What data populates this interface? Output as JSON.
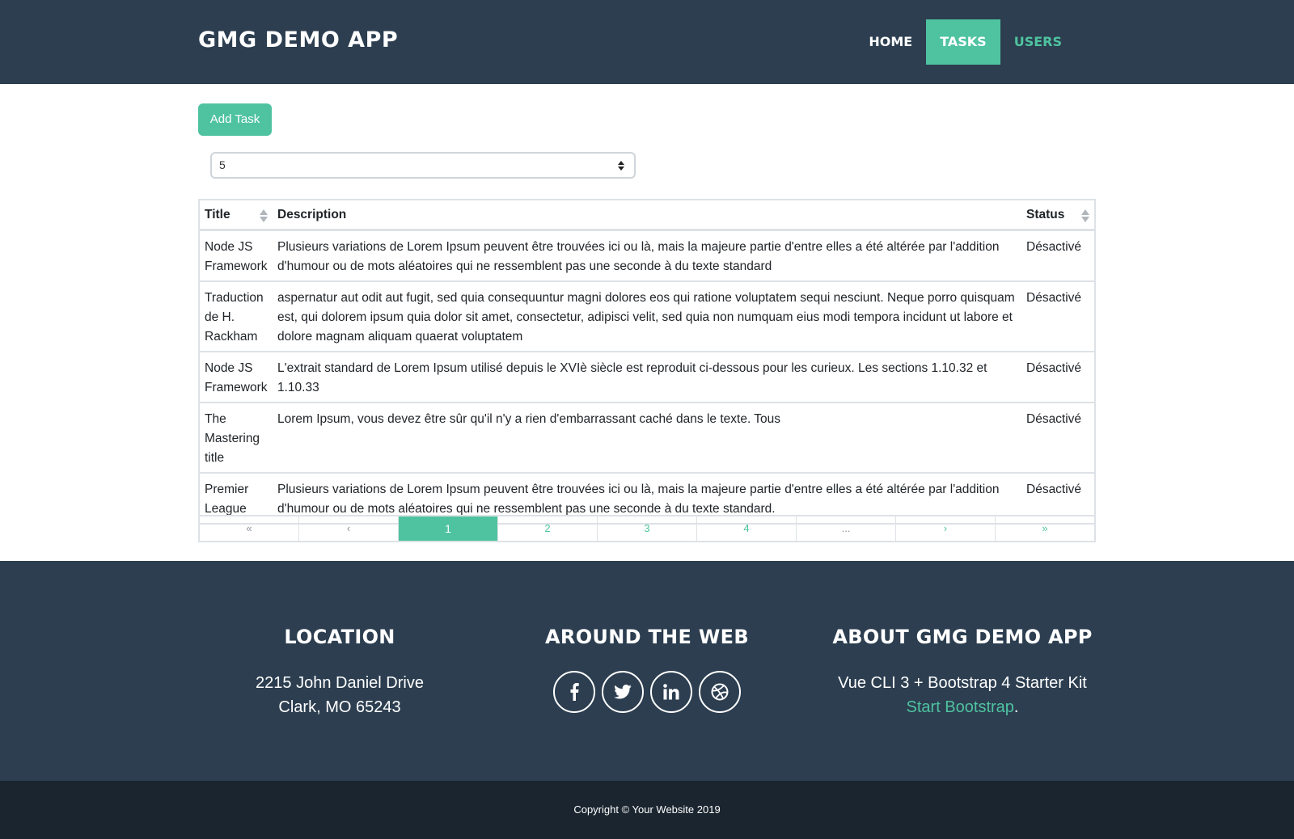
{
  "navbar": {
    "brand": "GMG DEMO APP",
    "items": [
      {
        "label": "HOME"
      },
      {
        "label": "TASKS"
      },
      {
        "label": "USERS"
      }
    ]
  },
  "main": {
    "add_task_label": "Add Task",
    "per_page_select": {
      "value": "5"
    },
    "table": {
      "headers": [
        "Title",
        "Description",
        "Status"
      ],
      "rows": [
        {
          "title": "Node JS Framework",
          "description": "Plusieurs variations de Lorem Ipsum peuvent être trouvées ici ou là, mais la majeure partie d'entre elles a été altérée par l'addition d'humour ou de mots aléatoires qui ne ressemblent pas une seconde à du texte standard",
          "status": "Désactivé"
        },
        {
          "title": "Traduction de H. Rackham",
          "description": "aspernatur aut odit aut fugit, sed quia consequuntur magni dolores eos qui ratione voluptatem sequi nesciunt. Neque porro quisquam est, qui dolorem ipsum quia dolor sit amet, consectetur, adipisci velit, sed quia non numquam eius modi tempora incidunt ut labore et dolore magnam aliquam quaerat voluptatem",
          "status": "Désactivé"
        },
        {
          "title": "Node JS Framework",
          "description": "L'extrait standard de Lorem Ipsum utilisé depuis le XVIè siècle est reproduit ci-dessous pour les curieux. Les sections 1.10.32 et 1.10.33",
          "status": "Désactivé"
        },
        {
          "title": "The Mastering title",
          "description": "Lorem Ipsum, vous devez être sûr qu'il n'y a rien d'embarrassant caché dans le texte. Tous",
          "status": "Désactivé"
        },
        {
          "title": "Premier League",
          "description": "Plusieurs variations de Lorem Ipsum peuvent être trouvées ici ou là, mais la majeure partie d'entre elles a été altérée par l'addition d'humour ou de mots aléatoires qui ne ressemblent pas une seconde à du texte standard.",
          "status": "Désactivé"
        }
      ]
    },
    "pagination": [
      "«",
      "‹",
      "1",
      "2",
      "3",
      "4",
      "...",
      "›",
      "»"
    ]
  },
  "footer": {
    "location": {
      "heading": "LOCATION",
      "line1": "2215 John Daniel Drive",
      "line2": "Clark, MO 65243"
    },
    "around": {
      "heading": "AROUND THE WEB",
      "icons": [
        "facebook-icon",
        "twitter-icon",
        "linkedin-icon",
        "dribbble-icon"
      ]
    },
    "about": {
      "heading": "ABOUT GMG DEMO APP",
      "line1": "Vue CLI 3 + Bootstrap 4 Starter Kit",
      "link": "Start Bootstrap",
      "suffix": "."
    },
    "copyright": "Copyright © Your Website 2019"
  },
  "colors": {
    "navbar_bg": "#2c3e50",
    "accent": "#4fc3a0",
    "copyright_bg": "#1a252f"
  }
}
